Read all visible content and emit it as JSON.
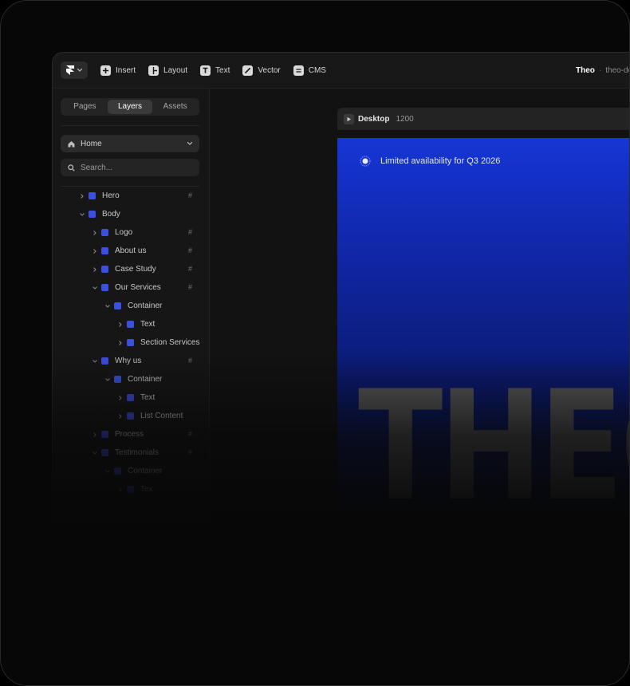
{
  "toolbar": {
    "insert": "Insert",
    "layout": "Layout",
    "text": "Text",
    "vector": "Vector",
    "cms": "CMS",
    "project_name": "Theo",
    "project_separator": "·",
    "project_slug": "theo-de"
  },
  "sidebar": {
    "tabs": [
      "Pages",
      "Layers",
      "Assets"
    ],
    "active_tab": "Layers",
    "page_select": "Home",
    "search_placeholder": "Search...",
    "layers": [
      {
        "label": "Hero",
        "depth": 0,
        "expanded": false,
        "hash": "#"
      },
      {
        "label": "Body",
        "depth": 0,
        "expanded": true,
        "hash": ""
      },
      {
        "label": "Logo",
        "depth": 1,
        "expanded": false,
        "hash": "#"
      },
      {
        "label": "About us",
        "depth": 1,
        "expanded": false,
        "hash": "#"
      },
      {
        "label": "Case Study",
        "depth": 1,
        "expanded": false,
        "hash": "#"
      },
      {
        "label": "Our Services",
        "depth": 1,
        "expanded": true,
        "hash": "#"
      },
      {
        "label": "Container",
        "depth": 2,
        "expanded": true,
        "hash": ""
      },
      {
        "label": "Text",
        "depth": 3,
        "expanded": false,
        "hash": ""
      },
      {
        "label": "Section Services",
        "depth": 3,
        "expanded": false,
        "hash": ""
      },
      {
        "label": "Why us",
        "depth": 1,
        "expanded": true,
        "hash": "#"
      },
      {
        "label": "Container",
        "depth": 2,
        "expanded": true,
        "hash": ""
      },
      {
        "label": "Text",
        "depth": 3,
        "expanded": false,
        "hash": ""
      },
      {
        "label": "List Content",
        "depth": 3,
        "expanded": false,
        "hash": ""
      },
      {
        "label": "Process",
        "depth": 1,
        "expanded": false,
        "hash": "#"
      },
      {
        "label": "Testimonials",
        "depth": 1,
        "expanded": true,
        "hash": "#"
      },
      {
        "label": "Container",
        "depth": 2,
        "expanded": true,
        "hash": ""
      },
      {
        "label": "Tex",
        "depth": 3,
        "expanded": false,
        "hash": ""
      }
    ]
  },
  "canvas": {
    "frame_name": "Desktop",
    "frame_width": "1200",
    "availability": "Limited availability for Q3 2026",
    "hero_word": "THEO"
  },
  "colors": {
    "accent": "#3a50e0",
    "site_top": "#1636d6",
    "background": "#070707"
  }
}
